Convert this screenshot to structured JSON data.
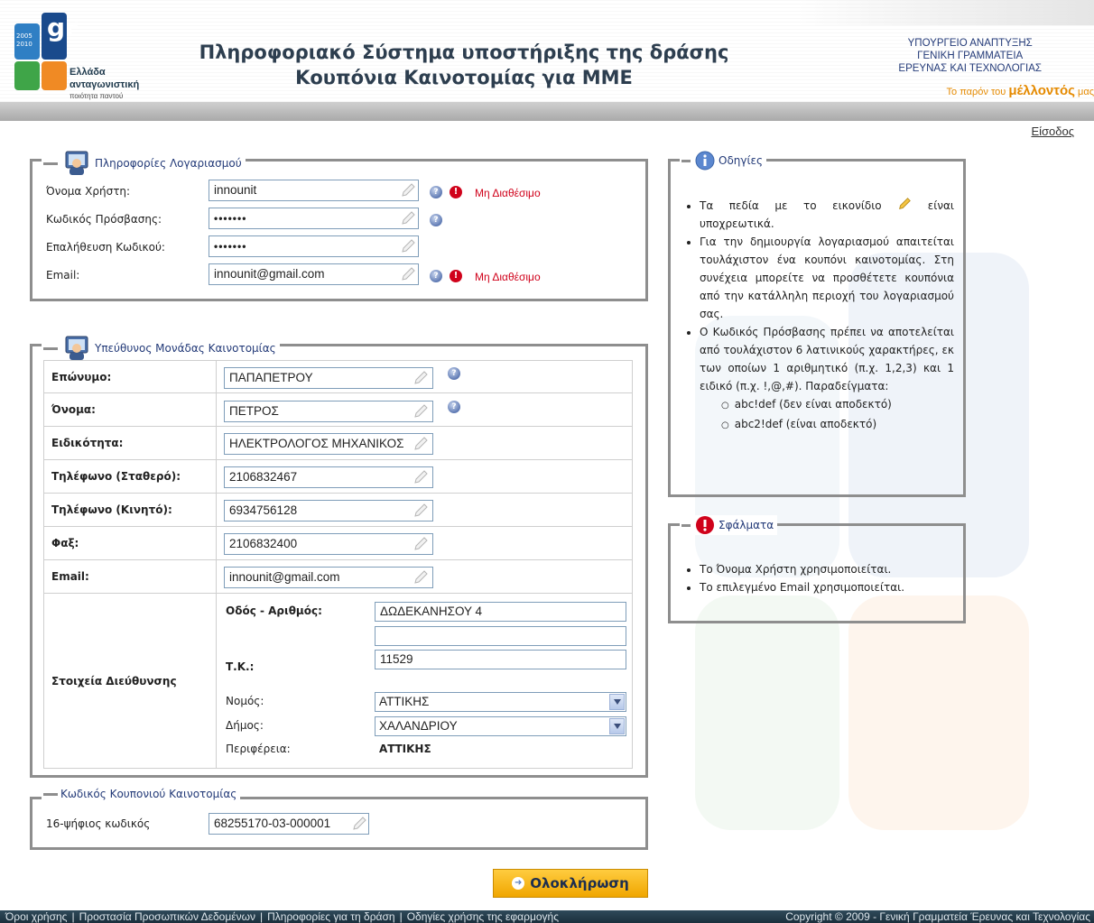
{
  "header": {
    "logo_text_1": "Ελλάδα",
    "logo_text_2": "ανταγωνιστική",
    "logo_text_3": "ποιότητα παντού",
    "logo_badge": "gr",
    "logo_years": "2005 2010",
    "title_line1": "Πληροφοριακό Σύστημα υποστήριξης της δράσης",
    "title_line2": "Κουπόνια Καινοτομίας για ΜΜΕ",
    "ministry_line1": "ΥΠΟΥΡΓΕΙΟ ΑΝΑΠΤΥΞΗΣ",
    "ministry_line2": "ΓΕΝΙΚΗ ΓΡΑΜΜΑΤΕΙΑ",
    "ministry_line3": "ΕΡΕΥΝΑΣ ΚΑΙ ΤΕΧΝΟΛΟΓΙΑΣ",
    "slogan_pre": "Το παρόν του ",
    "slogan_big": "μέλλοντός",
    "slogan_post": " μας",
    "login": "Είσοδος"
  },
  "account": {
    "legend": "Πληροφορίες Λογαριασμού",
    "username_label": "Όνομα Χρήστη:",
    "username_value": "innounit",
    "username_status": "Μη Διαθέσιμο",
    "password_label": "Κωδικός Πρόσβασης:",
    "password_value": "•••••••",
    "confirm_label": "Επαλήθευση Κωδικού:",
    "confirm_value": "•••••••",
    "email_label": "Email:",
    "email_value": "innounit@gmail.com",
    "email_status": "Μη Διαθέσιμο"
  },
  "manager": {
    "legend": "Υπεύθυνος Μονάδας Καινοτομίας",
    "surname_label": "Επώνυμο:",
    "surname_value": "ΠΑΠΑΠΕΤΡΟΥ",
    "name_label": "Όνομα:",
    "name_value": "ΠΕΤΡΟΣ",
    "specialty_label": "Ειδικότητα:",
    "specialty_value": "ΗΛΕΚΤΡΟΛΟΓΟΣ ΜΗΧΑΝΙΚΟΣ",
    "phone_label": "Τηλέφωνο (Σταθερό):",
    "phone_value": "2106832467",
    "mobile_label": "Τηλέφωνο (Κινητό):",
    "mobile_value": "6934756128",
    "fax_label": "Φαξ:",
    "fax_value": "2106832400",
    "email_label": "Email:",
    "email_value": "innounit@gmail.com",
    "address_label": "Στοιχεία Διεύθυνσης",
    "street_label": "Οδός - Αριθμός:",
    "street_value": "ΔΩΔΕΚΑΝΗΣΟΥ 4",
    "street2_value": "",
    "zip_label": "Τ.Κ.:",
    "zip_value": "11529",
    "prefecture_label": "Νομός:",
    "prefecture_value": "ΑΤΤΙΚΗΣ",
    "municipality_label": "Δήμος:",
    "municipality_value": "ΧΑΛΑΝΔΡΙΟΥ",
    "region_label": "Περιφέρεια:",
    "region_value": "ΑΤΤΙΚΗΣ"
  },
  "coupon": {
    "legend": "Κωδικός Κουπονιού Καινοτομίας",
    "code_label": "16-ψήφιος κωδικός",
    "code_value": "68255170-03-000001"
  },
  "instructions": {
    "legend": "Οδηγίες",
    "item1_pre": "Τα πεδία με το εικονίδιο",
    "item1_post": "είναι υποχρεωτικά.",
    "item2": "Για την δημιουργία λογαριασμού απαιτείται τουλάχιστον ένα κουπόνι καινοτομίας. Στη συνέχεια μπορείτε να προσθέτετε κουπόνια από την κατάλληλη περιοχή του λογαριασμού σας.",
    "item3": "Ο Κωδικός Πρόσβασης πρέπει να αποτελείται από τουλάχιστον 6 λατινικούς χαρακτήρες, εκ των οποίων 1 αριθμητικό (π.χ. 1,2,3) και 1 ειδικό (π.χ. !,@,#). Παραδείγματα:",
    "example1": "abc!def  (δεν είναι αποδεκτό)",
    "example2": "abc2!def (είναι αποδεκτό)"
  },
  "errors": {
    "legend": "Σφάλματα",
    "item1": "Το Όνομα Χρήστη χρησιμοποιείται.",
    "item2": "Το επιλεγμένο Email χρησιμοποιείται."
  },
  "submit_label": "Ολοκλήρωση",
  "footer": {
    "link1": "Όροι χρήσης",
    "link2": "Προστασία Προσωπικών Δεδομένων",
    "link3": "Πληροφορίες για τη δράση",
    "link4": "Οδηγίες χρήσης της εφαρμογής",
    "separator": "|",
    "copyright": "Copyright © 2009 - Γενική Γραμματεία Έρευνας και Τεχνολογίας"
  },
  "colors": {
    "accent_orange": "#f0a600",
    "title_navy": "#233a78",
    "error_red": "#d0021b",
    "footer_dark": "#1b2f3c"
  },
  "icons": [
    "pencil-icon",
    "help-icon",
    "error-icon",
    "user-icon",
    "info-icon",
    "chevron-down-icon"
  ]
}
